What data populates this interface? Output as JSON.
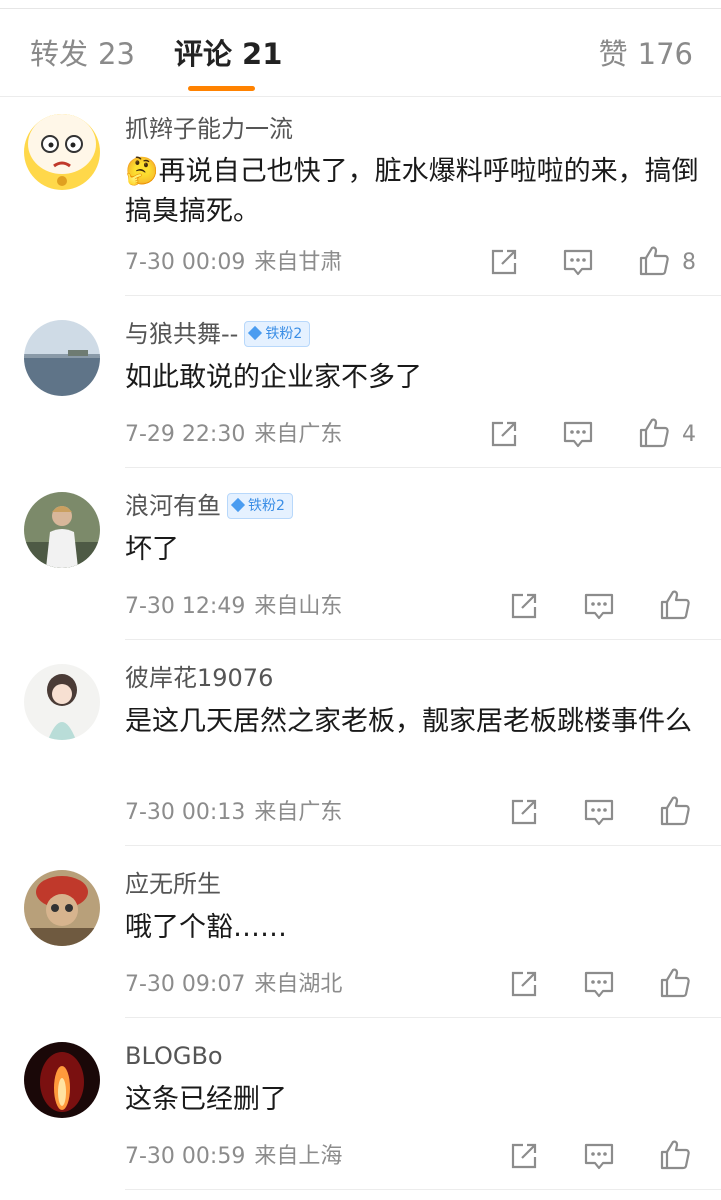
{
  "tabs": {
    "repost": {
      "label": "转发",
      "count": "23"
    },
    "comments": {
      "label": "评论",
      "count": "21"
    },
    "likes": {
      "label": "赞",
      "count": "176"
    }
  },
  "comments": [
    {
      "username": "抓辫子能力一流",
      "badge": "",
      "emoji": "🤔",
      "text": "再说自己也快了，脏水爆料呼啦啦的来，搞倒搞臭搞死。",
      "time": "7-30 00:09",
      "location": "来自甘肃",
      "likes": "8"
    },
    {
      "username": "与狼共舞--",
      "badge": "铁粉2",
      "text": "如此敢说的企业家不多了",
      "time": "7-29 22:30",
      "location": "来自广东",
      "likes": "4"
    },
    {
      "username": "浪河有鱼",
      "badge": "铁粉2",
      "text": "坏了",
      "time": "7-30 12:49",
      "location": "来自山东",
      "likes": ""
    },
    {
      "username": "彼岸花19076",
      "badge": "",
      "text": "是这几天居然之家老板，靓家居老板跳楼事件么",
      "time": "7-30 00:13",
      "location": "来自广东",
      "likes": ""
    },
    {
      "username": "应无所生",
      "badge": "",
      "text": "哦了个豁……",
      "time": "7-30 09:07",
      "location": "来自湖北",
      "likes": ""
    },
    {
      "username": "BLOGBo",
      "badge": "",
      "text": "这条已经删了",
      "time": "7-30 00:59",
      "location": "来自上海",
      "likes": ""
    }
  ],
  "icons": {
    "share": "share-icon",
    "reply": "comment-icon",
    "like": "thumbs-up-icon"
  },
  "colors": {
    "accent": "#ff8200",
    "badge_bg": "#e5f1ff",
    "badge_text": "#3a8ee6"
  }
}
